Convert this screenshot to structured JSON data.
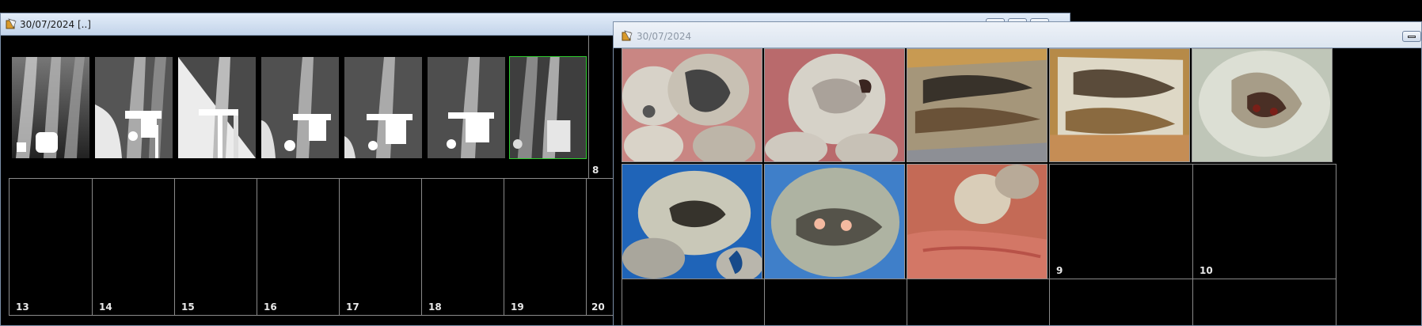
{
  "windows": {
    "xray": {
      "title": "30/07/2024 [..]"
    },
    "photo": {
      "title": "30/07/2024"
    }
  },
  "xray_strip": {
    "count_label": "8"
  },
  "xray_slots": [
    "13",
    "14",
    "15",
    "16",
    "17",
    "18",
    "19",
    "20"
  ],
  "photo_slots": {
    "slot9": "9",
    "slot10": "10"
  },
  "colors": {
    "selection": "#2ecc2e",
    "grid": "#8a8a8a",
    "title_active": "#c3d4ea"
  }
}
